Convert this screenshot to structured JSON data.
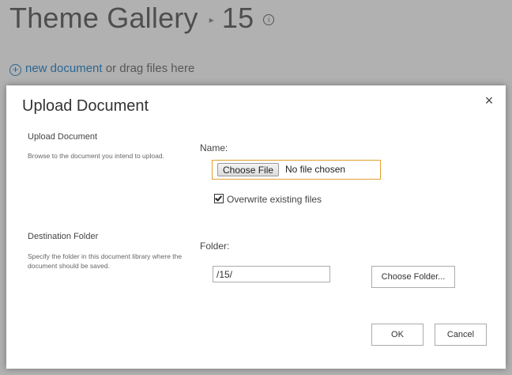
{
  "background": {
    "title": "Theme Gallery",
    "separator": "▸",
    "subtitle": "15",
    "info_icon": "i",
    "new_document_link": "new document",
    "new_document_suffix": "or drag files here"
  },
  "dialog": {
    "title": "Upload Document",
    "close_label": "×",
    "upload_section": {
      "title": "Upload Document",
      "description": "Browse to the document you intend to upload."
    },
    "name_label": "Name:",
    "choose_file_label": "Choose File",
    "file_status": "No file chosen",
    "overwrite_label": "Overwrite existing files",
    "overwrite_checked": true,
    "destination_section": {
      "title": "Destination Folder",
      "description": "Specify the folder in this document library where the document should be saved."
    },
    "folder_label": "Folder:",
    "folder_value": "/15/",
    "choose_folder_label": "Choose Folder...",
    "ok_label": "OK",
    "cancel_label": "Cancel"
  },
  "colors": {
    "accent": "#0072c6",
    "focus_border": "#e0a030"
  }
}
